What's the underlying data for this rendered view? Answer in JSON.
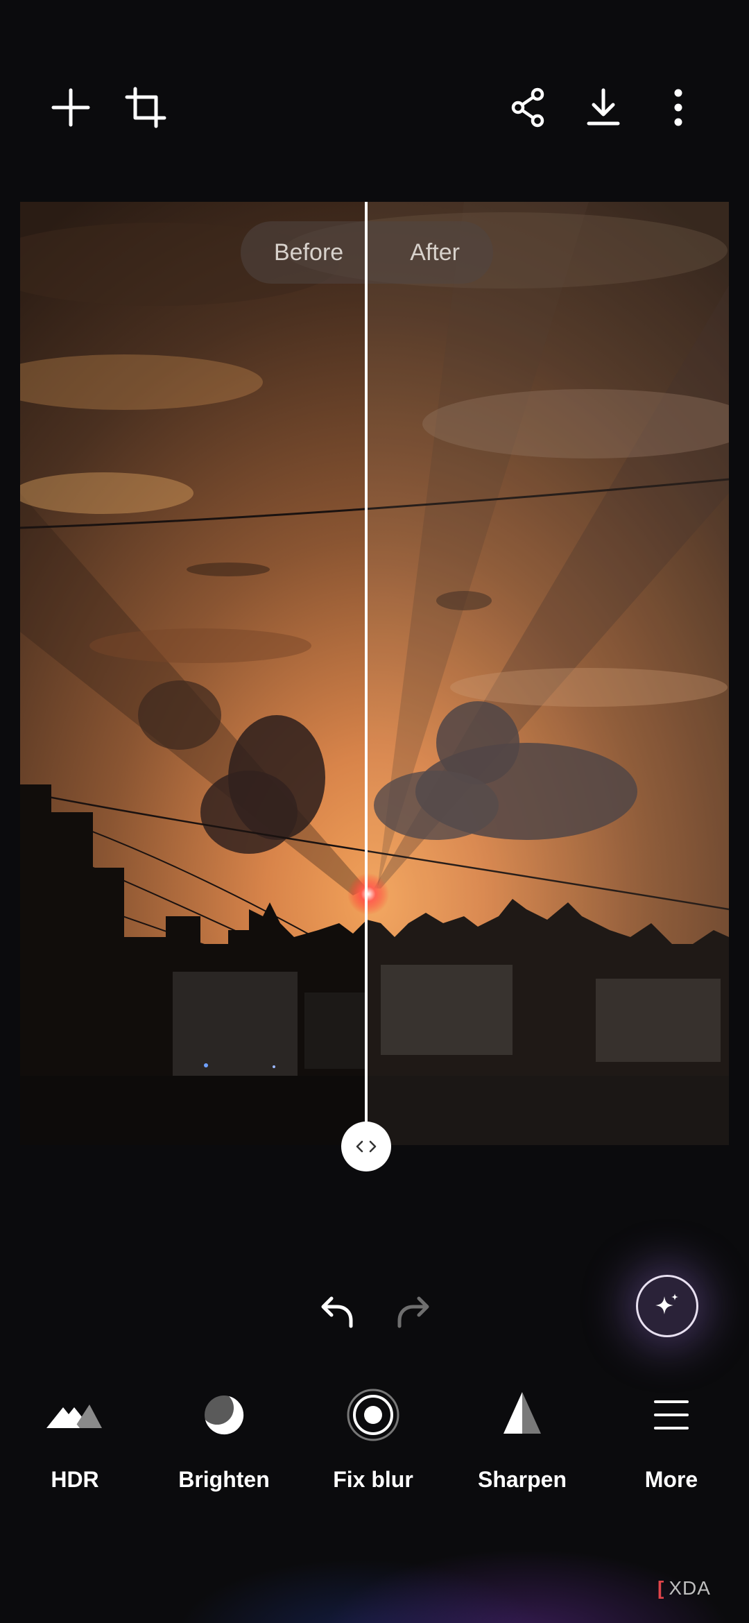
{
  "toolbar": {
    "add_icon": "plus-icon",
    "crop_icon": "crop-icon",
    "share_icon": "share-icon",
    "download_icon": "download-icon",
    "more_icon": "more-vertical-icon"
  },
  "compare": {
    "before_label": "Before",
    "after_label": "After",
    "handle_icon": "chevrons-left-right-icon"
  },
  "history": {
    "undo_icon": "undo-icon",
    "redo_icon": "redo-icon"
  },
  "magic_button_icon": "sparkle-icon",
  "tools": [
    {
      "label": "HDR",
      "icon": "mountains-icon"
    },
    {
      "label": "Brighten",
      "icon": "moon-icon"
    },
    {
      "label": "Fix blur",
      "icon": "target-icon"
    },
    {
      "label": "Sharpen",
      "icon": "triangle-icon"
    },
    {
      "label": "More",
      "icon": "menu-icon"
    }
  ],
  "watermark": {
    "text": "XDA"
  }
}
